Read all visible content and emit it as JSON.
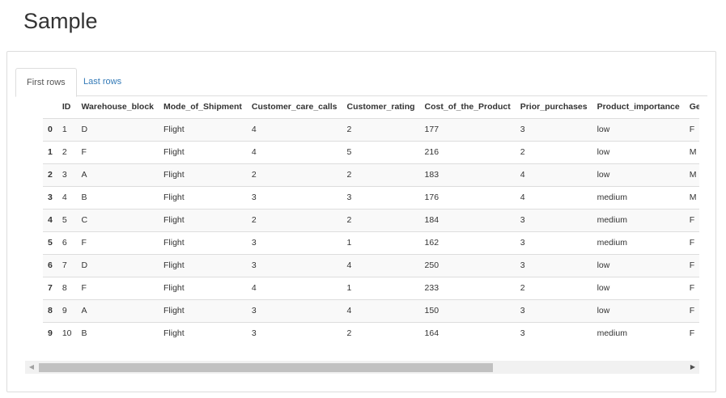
{
  "page": {
    "title": "Sample"
  },
  "tabs": {
    "first": "First rows",
    "last": "Last rows"
  },
  "table": {
    "columns": [
      "",
      "ID",
      "Warehouse_block",
      "Mode_of_Shipment",
      "Customer_care_calls",
      "Customer_rating",
      "Cost_of_the_Product",
      "Prior_purchases",
      "Product_importance",
      "Ge"
    ],
    "rows": [
      [
        "0",
        "1",
        "D",
        "Flight",
        "4",
        "2",
        "177",
        "3",
        "low",
        "F"
      ],
      [
        "1",
        "2",
        "F",
        "Flight",
        "4",
        "5",
        "216",
        "2",
        "low",
        "M"
      ],
      [
        "2",
        "3",
        "A",
        "Flight",
        "2",
        "2",
        "183",
        "4",
        "low",
        "M"
      ],
      [
        "3",
        "4",
        "B",
        "Flight",
        "3",
        "3",
        "176",
        "4",
        "medium",
        "M"
      ],
      [
        "4",
        "5",
        "C",
        "Flight",
        "2",
        "2",
        "184",
        "3",
        "medium",
        "F"
      ],
      [
        "5",
        "6",
        "F",
        "Flight",
        "3",
        "1",
        "162",
        "3",
        "medium",
        "F"
      ],
      [
        "6",
        "7",
        "D",
        "Flight",
        "3",
        "4",
        "250",
        "3",
        "low",
        "F"
      ],
      [
        "7",
        "8",
        "F",
        "Flight",
        "4",
        "1",
        "233",
        "2",
        "low",
        "F"
      ],
      [
        "8",
        "9",
        "A",
        "Flight",
        "3",
        "4",
        "150",
        "3",
        "low",
        "F"
      ],
      [
        "9",
        "10",
        "B",
        "Flight",
        "3",
        "2",
        "164",
        "3",
        "medium",
        "F"
      ]
    ]
  },
  "scrollbar": {
    "left_icon": "arrow-left-icon",
    "right_icon": "arrow-right-icon",
    "left_glyph": "◀",
    "right_glyph": "▶"
  }
}
